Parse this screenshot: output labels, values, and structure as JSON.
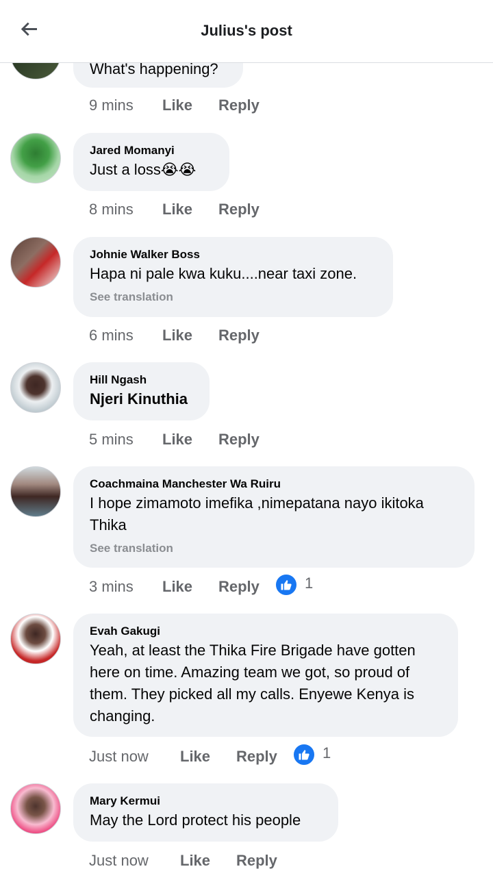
{
  "header": {
    "title": "Julius's post",
    "back_icon": "arrow-left-icon"
  },
  "actions": {
    "like": "Like",
    "reply": "Reply"
  },
  "comments": [
    {
      "author": "",
      "text": "What's happening?",
      "time": "9 mins"
    },
    {
      "author": "Jared Momanyi",
      "text": "Just a loss😭😭",
      "time": "8 mins"
    },
    {
      "author": "Johnie Walker Boss",
      "text": "Hapa ni pale kwa kuku....near taxi zone.",
      "translation": "See translation",
      "time": "6 mins"
    },
    {
      "author": "Hill Ngash",
      "text": "Njeri Kinuthia",
      "time": "5 mins"
    },
    {
      "author": "Coachmaina Manchester Wa Ruiru",
      "text": "I hope zimamoto imefika ,nimepatana nayo ikitoka Thika",
      "translation": "See translation",
      "time": "3 mins",
      "reaction_count": "1"
    },
    {
      "author": "Evah Gakugi",
      "text": "Yeah, at least the Thika Fire Brigade have gotten here on time. Amazing team we got, so proud of them. They picked all my calls. Enyewe Kenya is changing.",
      "time": "Just now",
      "reaction_count": "1"
    },
    {
      "author": "Mary Kermui",
      "text": "May the Lord protect his people",
      "time": "Just now"
    }
  ],
  "colors": {
    "accent": "#1877f2",
    "bubble": "#f0f2f5",
    "meta_text": "#65676b"
  }
}
